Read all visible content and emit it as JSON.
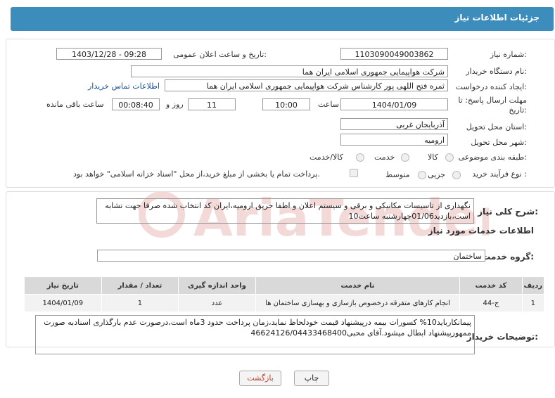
{
  "header": {
    "title": "جزئیات اطلاعات نیاز"
  },
  "form": {
    "need_number_label": "شماره نیاز:",
    "need_number": "1103090049003862",
    "announce_label": "تاریخ و ساعت اعلان عمومی:",
    "announce_value": "1403/12/28 - 09:28",
    "buyer_org_label": "نام دستگاه خریدار:",
    "buyer_org": "شرکت هواپیمایی جمهوری اسلامی ایران هما",
    "requester_label": "ایجاد کننده درخواست:",
    "requester": "ثمره فتح اللهی پور کارشناس شرکت هواپیمایی جمهوری اسلامی ایران هما",
    "contact_link": "اطلاعات تماس خریدار",
    "deadline_label_1": "مهلت ارسال پاسخ: تا",
    "deadline_label_2": "تاریخ:",
    "deadline_date": "1404/01/09",
    "time_label": "ساعت",
    "deadline_time": "10:00",
    "days_value": "11",
    "days_label": "روز و",
    "remaining_time": "00:08:40",
    "remaining_label": "ساعت باقی مانده",
    "province_label": "استان محل تحویل:",
    "province": "آذربایجان غربی",
    "city_label": "شهر محل تحویل:",
    "city": "ارومیه",
    "category_label": "طبقه بندی موضوعی:",
    "category_options": [
      "کالا",
      "خدمت",
      "کالا/خدمت"
    ],
    "process_label": "نوع فرآیند خرید :",
    "process_options": [
      "جزیی",
      "متوسط"
    ],
    "payment_note": "پرداخت تمام یا بخشی از مبلغ خرید،از محل \"اسناد خزانه اسلامی\" خواهد بود."
  },
  "summary": {
    "label": "شرح کلی نیاز:",
    "text": "نگهداری از تاسیسات مکانیکی و برقی و سیستم اعلان و اطفا حریق ارومیه،ایران کد انتخاب شده صرفا جهت تشابه است،بازدید01/06چهارشنبه ساعت10"
  },
  "services": {
    "section_title": "اطلاعات خدمات مورد نیاز",
    "group_label": "گروه خدمت:",
    "group_value": "ساختمان",
    "columns": [
      "ردیف",
      "کد خدمت",
      "نام خدمت",
      "واحد اندازه گیری",
      "تعداد / مقدار",
      "تاریخ نیاز"
    ],
    "rows": [
      [
        "1",
        "ج-44",
        "انجام کارهای متفرقه درخصوص بازسازی و بهسازی ساختمان ها",
        "عدد",
        "1",
        "1404/01/09"
      ]
    ]
  },
  "buyer_notes": {
    "label": "توضیحات خریدار:",
    "text": "پیمانکارباید10% کسورات بیمه درپیشنهاد قیمت خودلحاظ نماید،زمان پرداخت حدود 3ماه است،درصورت عدم بارگذاری اسنادبه صورت ممهورپیشنهاد ابطال میشود.آقای محبی46624126/04433468400"
  },
  "buttons": {
    "print": "چاپ",
    "back": "بازگشت"
  },
  "watermark": {
    "text": "AriaTender.net"
  },
  "colors": {
    "header": "#3c8dbc",
    "link": "#1a4fa0",
    "back_text": "#c0392b"
  }
}
